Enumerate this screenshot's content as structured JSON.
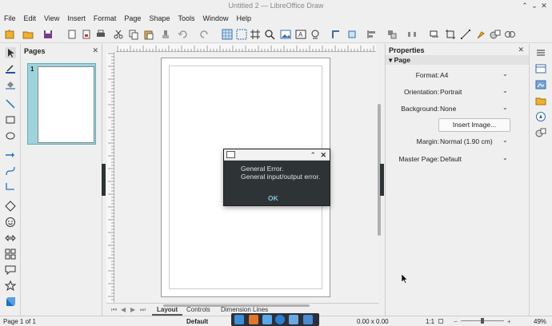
{
  "window": {
    "title": "Untitled 2 — LibreOffice Draw"
  },
  "menu": [
    "File",
    "Edit",
    "View",
    "Insert",
    "Format",
    "Page",
    "Shape",
    "Tools",
    "Window",
    "Help"
  ],
  "pages_panel": {
    "title": "Pages",
    "close": "✕",
    "thumb_number": "1"
  },
  "properties": {
    "title": "Properties",
    "close": "✕",
    "section": "Page",
    "rows": [
      {
        "label": "Format:",
        "value": "A4"
      },
      {
        "label": "Orientation:",
        "value": "Portrait"
      },
      {
        "label": "Background:",
        "value": "None"
      },
      {
        "label": "Margin:",
        "value": "Normal (1.90 cm)"
      },
      {
        "label": "Master Page:",
        "value": "Default"
      }
    ],
    "insert_image": "Insert Image..."
  },
  "tabs": [
    "Layout",
    "Controls",
    "Dimension Lines"
  ],
  "dialog": {
    "line1": "General Error.",
    "line2": "General input/output error.",
    "ok": "OK"
  },
  "status": {
    "page": "Page 1 of 1",
    "master": "Default",
    "position": "0.00 x 0.00",
    "scale": "1:1",
    "zoom": "49%"
  },
  "colors": {
    "accent": "#5fb0bd",
    "dialog_bg": "#2e3436",
    "ok": "#7ec3d6",
    "selection_thumb": "#9fd3dc"
  }
}
